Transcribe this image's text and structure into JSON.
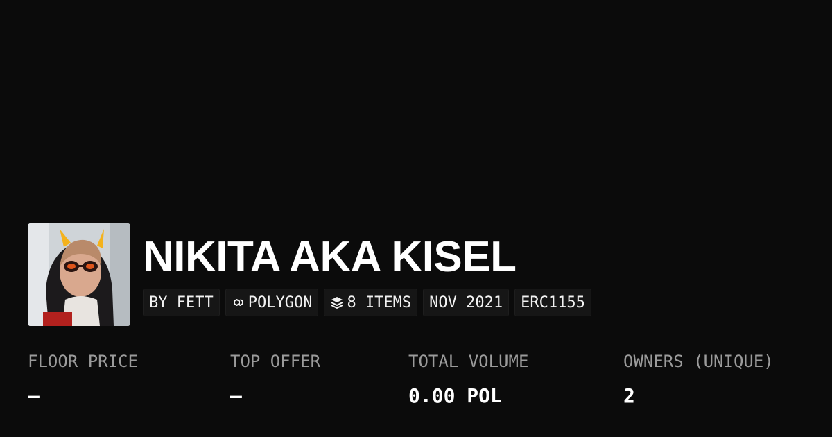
{
  "collection": {
    "title": "NIKITA AKA KISEL",
    "avatar_icon": "collection-avatar-photo",
    "tags": {
      "creator": "BY FETT",
      "chain": "POLYGON",
      "chain_icon": "polygon-logo-icon",
      "items": "8 ITEMS",
      "items_icon": "layers-icon",
      "date": "NOV 2021",
      "standard": "ERC1155"
    }
  },
  "stats": {
    "floor_price": {
      "label": "FLOOR PRICE",
      "value": "—"
    },
    "top_offer": {
      "label": "TOP OFFER",
      "value": "—"
    },
    "total_volume": {
      "label": "TOTAL VOLUME",
      "value": "0.00 POL"
    },
    "owners": {
      "label": "OWNERS (UNIQUE)",
      "value": "2"
    }
  },
  "colors": {
    "background": "#0b0b0b",
    "tag_background": "#161616",
    "label_gray": "#9b9b9b",
    "text_white": "#ffffff"
  }
}
